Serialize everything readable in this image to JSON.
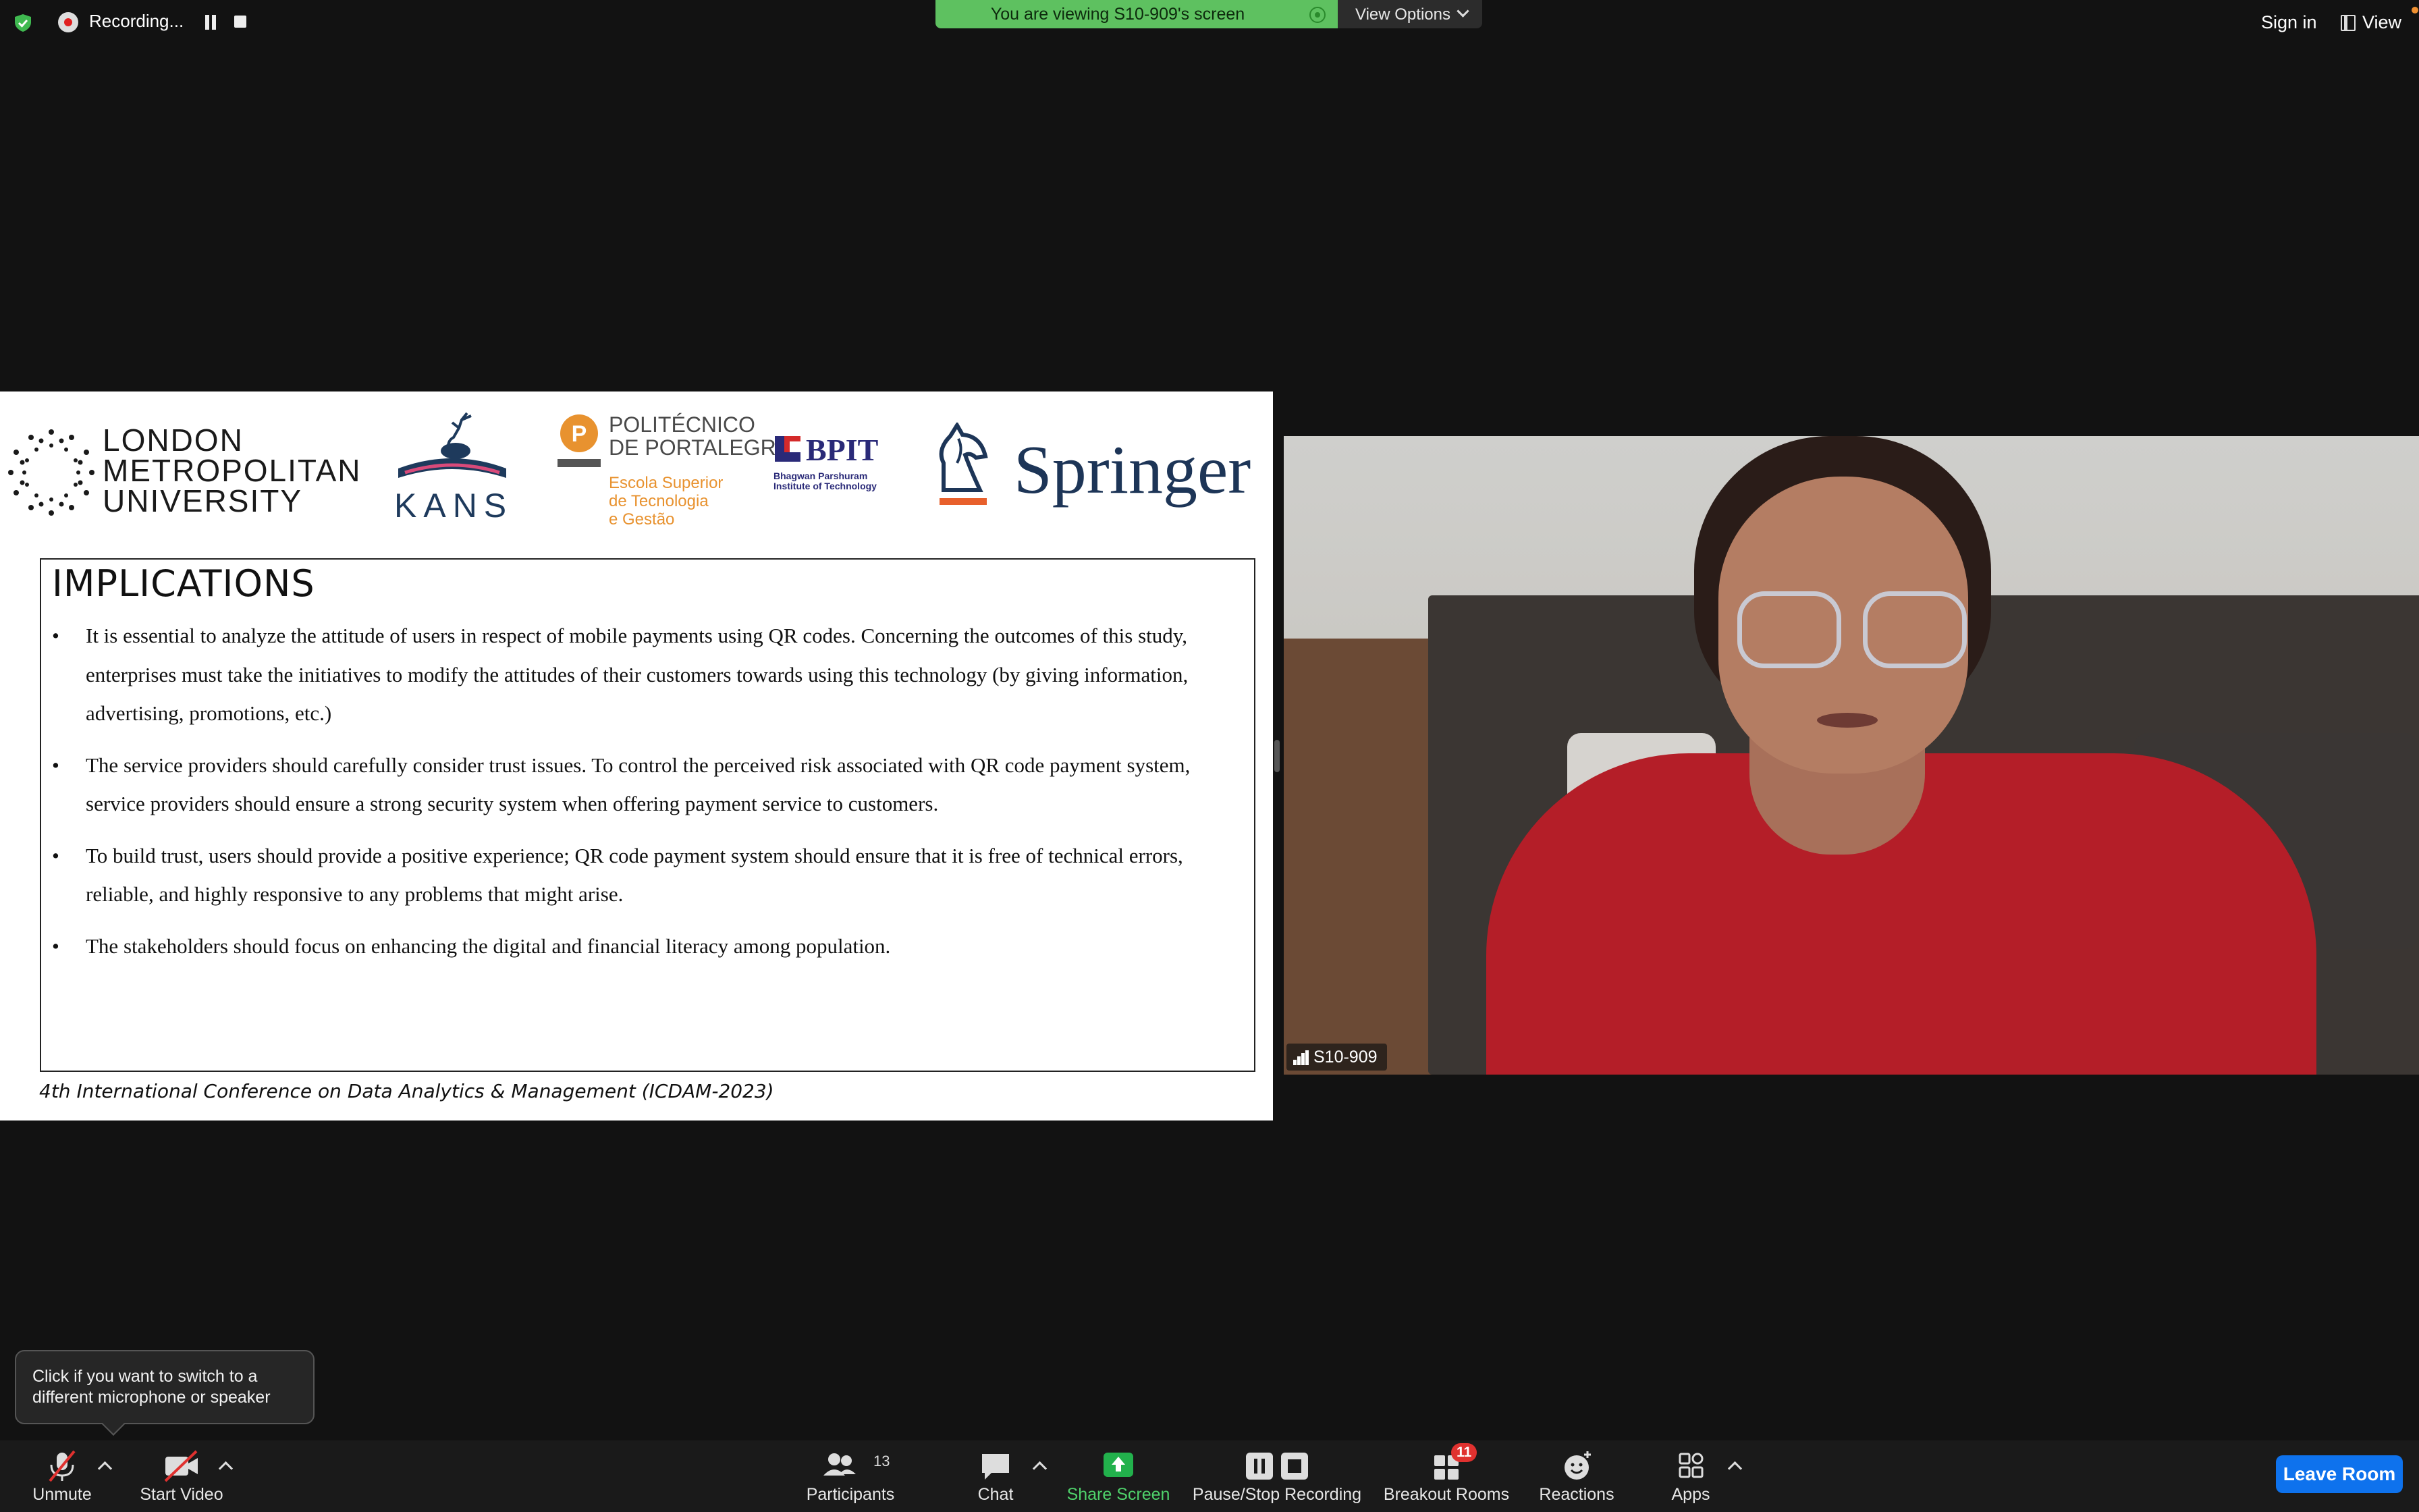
{
  "top_bar": {
    "recording_label": "Recording...",
    "viewing_banner": "You are viewing S10-909's screen",
    "view_options_label": "View Options",
    "sign_in_label": "Sign in",
    "view_label": "View"
  },
  "slide": {
    "logos": {
      "lmu": "LONDON\nMETROPOLITAN\nUNIVERSITY",
      "kans": "KANS",
      "politecnico_name": "POLITÉCNICO\nDE PORTALEGRE",
      "politecnico_sub": "Escola Superior\nde Tecnologia\ne Gestão",
      "bpit_name": "BPIT",
      "bpit_sub": "Bhagwan Parshuram\nInstitute of Technology",
      "springer": "Springer"
    },
    "title": "IMPLICATIONS",
    "bullets": [
      "It is essential to analyze the attitude of users in respect of mobile payments using QR codes. Concerning the outcomes of this study, enterprises must take the initiatives to modify the attitudes of their customers towards using this technology (by giving information, advertising, promotions, etc.)",
      "The service providers should carefully consider trust issues. To control the perceived risk associated with QR code payment system, service providers should ensure a strong security system when offering  payment service to customers.",
      "To build trust, users should provide a positive experience; QR code payment system should ensure that it is free of technical errors, reliable, and highly responsive to any problems that might arise.",
      "The stakeholders should focus on enhancing the digital and financial literacy among population."
    ],
    "footer": "4th International Conference on Data Analytics & Management (ICDAM-2023)"
  },
  "video": {
    "participant_name": "S10-909"
  },
  "tooltip": {
    "text": "Click if you want to switch to a different microphone or speaker"
  },
  "toolbar": {
    "unmute": "Unmute",
    "start_video": "Start Video",
    "participants": "Participants",
    "participants_count": "13",
    "chat": "Chat",
    "share_screen": "Share Screen",
    "pause_stop_recording": "Pause/Stop Recording",
    "breakout_rooms": "Breakout Rooms",
    "breakout_badge": "11",
    "reactions": "Reactions",
    "apps": "Apps",
    "leave_room": "Leave Room"
  },
  "colors": {
    "background": "#121212",
    "banner_green": "#5ec160",
    "share_green": "#22b14c",
    "leave_blue": "#0e72ed",
    "badge_red": "#e0312f"
  },
  "icons": [
    "shield-icon",
    "record-icon",
    "pause-icon",
    "stop-icon",
    "chevron-down-icon",
    "view-icon",
    "microphone-muted-icon",
    "video-muted-icon",
    "participants-icon",
    "chat-icon",
    "share-screen-icon",
    "pause-recording-icon",
    "breakout-rooms-icon",
    "reactions-icon",
    "apps-icon",
    "signal-icon"
  ]
}
